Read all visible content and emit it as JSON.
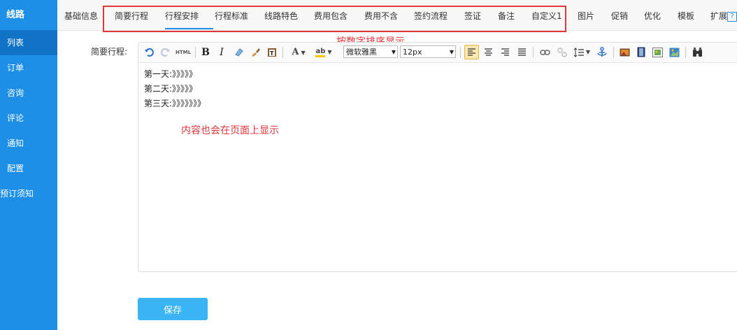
{
  "sidebar": {
    "title": "线路",
    "items": [
      {
        "label": "列表",
        "active": true
      },
      {
        "label": "订单"
      },
      {
        "label": "咨询"
      },
      {
        "label": "评论"
      },
      {
        "label": "通知"
      },
      {
        "label": "配置"
      },
      {
        "label": "预订须知"
      }
    ]
  },
  "tabs": [
    "基础信息",
    "简要行程",
    "行程安排",
    "行程标准",
    "线路特色",
    "费用包含",
    "费用不含",
    "签约流程",
    "签证",
    "备注",
    "自定义1",
    "图片",
    "促销",
    "优化",
    "模板",
    "扩展"
  ],
  "active_tab": "简要行程",
  "annotations": {
    "sort_note": "按数字排序显示",
    "content_note": "内容也会在页面上显示"
  },
  "form": {
    "field_label": "简要行程:",
    "font_family_value": "微软雅黑",
    "font_size_value": "12px",
    "content_lines": [
      "第一天:》》》》》",
      "第二天:》》》》》",
      "第三天:》》》》》》》"
    ],
    "save_label": "保存"
  },
  "toolbar_icons": [
    "undo-icon",
    "redo-icon",
    "html-source-icon",
    "bold-icon",
    "italic-icon",
    "eraser-icon",
    "format-brush-icon",
    "paste-text-icon",
    "font-color-icon",
    "highlight-color-icon",
    "align-left-icon",
    "align-center-icon",
    "align-right-icon",
    "justify-icon",
    "link-icon",
    "unlink-icon",
    "line-height-icon",
    "anchor-icon",
    "image-icon",
    "video-icon",
    "gallery-icon",
    "map-icon",
    "binoculars-icon"
  ],
  "colors": {
    "sidebar_bg": "#1e8fe7",
    "sidebar_active": "#1073c6",
    "annotation_red": "#e0373b",
    "save_button": "#3ab4f2"
  }
}
